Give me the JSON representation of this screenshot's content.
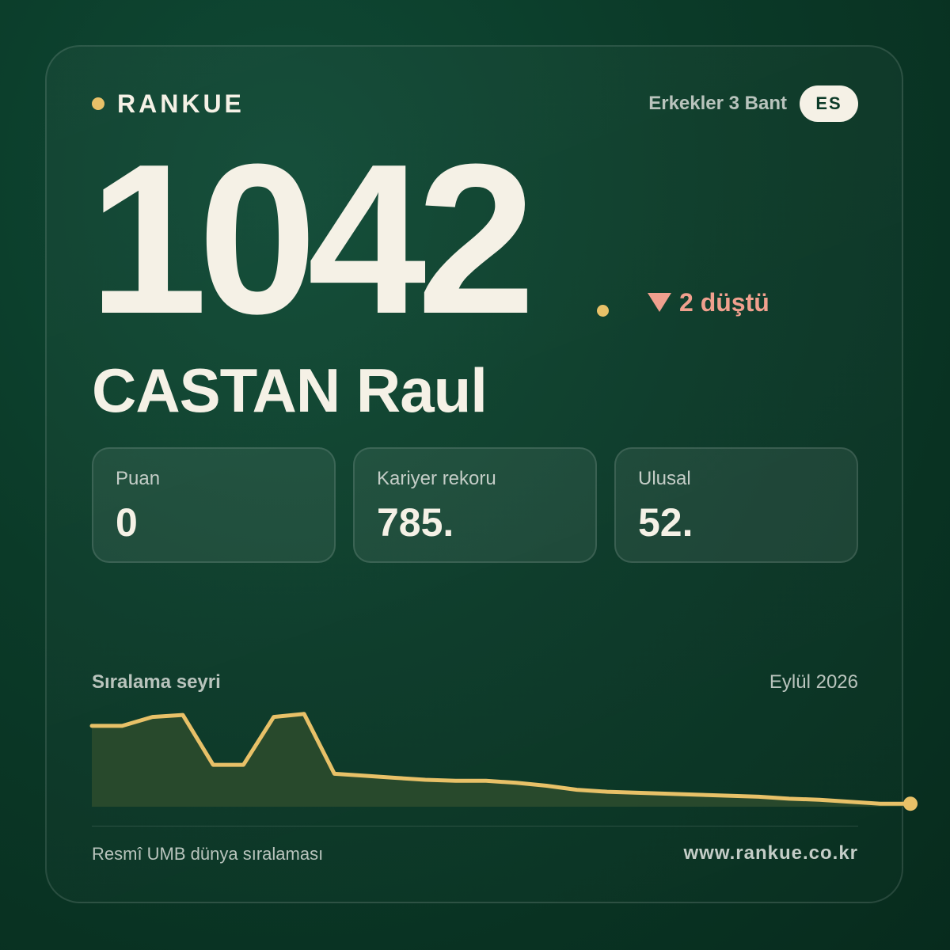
{
  "brand": {
    "name": "RANKUE"
  },
  "header": {
    "category": "Erkekler 3 Bant",
    "country_code": "ES"
  },
  "rank": {
    "value": "1042",
    "change_text": "2 düştü",
    "change_direction": "down"
  },
  "player": {
    "name": "CASTAN Raul"
  },
  "stats": [
    {
      "label": "Puan",
      "value": "0"
    },
    {
      "label": "Kariyer rekoru",
      "value": "785."
    },
    {
      "label": "Ulusal",
      "value": "52."
    }
  ],
  "trend": {
    "title": "Sıralama seyri",
    "date": "Eylül 2026"
  },
  "footer": {
    "source": "Resmî UMB dünya sıralaması",
    "url": "www.rankue.co.kr"
  },
  "colors": {
    "accent": "#e8c168",
    "down": "#f0a08e",
    "text": "#f5f1e6",
    "background": "#0b3a28"
  },
  "chart_data": {
    "type": "area",
    "values": [
      0.81,
      0.81,
      0.9,
      0.92,
      0.42,
      0.42,
      0.9,
      0.93,
      0.33,
      0.31,
      0.29,
      0.27,
      0.26,
      0.26,
      0.24,
      0.21,
      0.17,
      0.15,
      0.14,
      0.13,
      0.12,
      0.11,
      0.1,
      0.08,
      0.07,
      0.05,
      0.03,
      0.03
    ]
  }
}
